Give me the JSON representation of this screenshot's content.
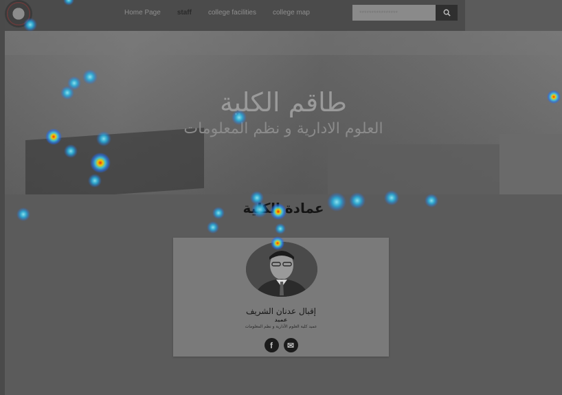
{
  "nav": {
    "items": [
      {
        "label": "Home Page",
        "active": false
      },
      {
        "label": "staff",
        "active": true
      },
      {
        "label": "college facilities",
        "active": false
      },
      {
        "label": "college map",
        "active": false
      }
    ],
    "search_placeholder": "****************"
  },
  "hero": {
    "title": "طاقم الكلية",
    "subtitle": "العلوم الادارية و نظم المعلومات"
  },
  "section": {
    "title": "عمادة الكلية"
  },
  "staff_card": {
    "name": "إقبال عدنان الشريف",
    "role": "عميد",
    "description": "عميد كلية العلوم الأدارية و نظم المعلومات",
    "social": [
      {
        "icon": "facebook-icon",
        "glyph": "f"
      },
      {
        "icon": "email-icon",
        "glyph": "✉"
      }
    ]
  },
  "colors": {
    "page_bg": "#5b5b5b",
    "header_bg": "#4b4b4b",
    "card_bg": "#7a7a7a",
    "heat_hot": "#ff2a00",
    "heat_warm": "#ffd400",
    "heat_cool": "#1e90ff"
  }
}
